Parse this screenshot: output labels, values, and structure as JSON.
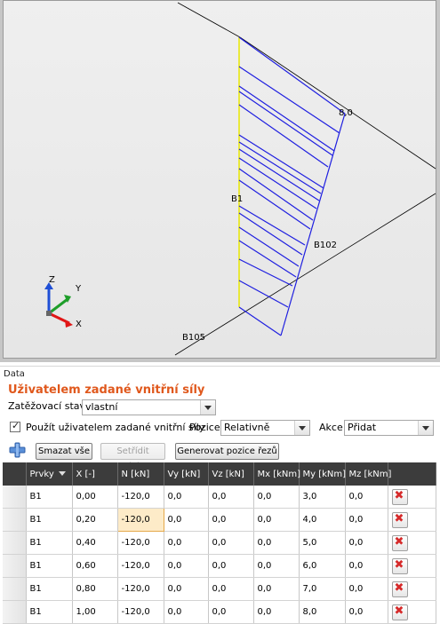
{
  "scene": {
    "labels": {
      "top_value": "8,0",
      "member": "B1",
      "node_mid": "B102",
      "node_bottom": "B105"
    },
    "axes": {
      "z": "Z",
      "y": "Y",
      "x": "X"
    }
  },
  "panel": {
    "caption": "Data",
    "title": "Uživatelem zadané vnitřní síly",
    "load_case_label": "Zatěžovací stav",
    "load_case_value": "vlastní",
    "use_forces_label": "Použít uživatelem zadané vnitřní síly",
    "use_forces_checked": true,
    "position_label": "Pozice",
    "position_value": "Relativně",
    "action_label": "Akce",
    "action_value": "Přidat",
    "buttons": {
      "delete_all": "Smazat vše",
      "sort": "Setřídit polohy",
      "generate": "Generovat pozice řezů"
    }
  },
  "table": {
    "columns": [
      "Prvky",
      "X [-]",
      "N [kN]",
      "Vy [kN]",
      "Vz [kN]",
      "Mx [kNm]",
      "My [kNm]",
      "Mz [kNm]"
    ],
    "rows": [
      [
        "B1",
        "0,00",
        "-120,0",
        "0,0",
        "0,0",
        "0,0",
        "3,0",
        "0,0"
      ],
      [
        "B1",
        "0,20",
        "-120,0",
        "0,0",
        "0,0",
        "0,0",
        "4,0",
        "0,0"
      ],
      [
        "B1",
        "0,40",
        "-120,0",
        "0,0",
        "0,0",
        "0,0",
        "5,0",
        "0,0"
      ],
      [
        "B1",
        "0,60",
        "-120,0",
        "0,0",
        "0,0",
        "0,0",
        "6,0",
        "0,0"
      ],
      [
        "B1",
        "0,80",
        "-120,0",
        "0,0",
        "0,0",
        "0,0",
        "7,0",
        "0,0"
      ],
      [
        "B1",
        "1,00",
        "-120,0",
        "0,0",
        "0,0",
        "0,0",
        "8,0",
        "0,0"
      ]
    ]
  },
  "colors": {
    "accent": "#e0581c",
    "diagram": "#1f1fe0",
    "member": "#e8e800",
    "header": "#3c3c3c"
  }
}
